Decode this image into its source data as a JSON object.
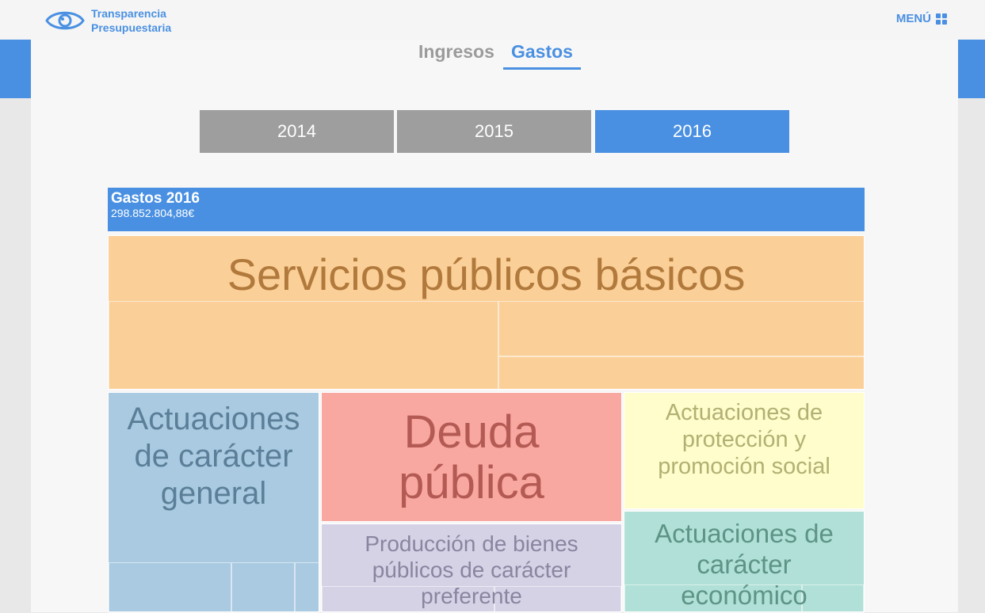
{
  "header": {
    "logo_line1": "Transparencia",
    "logo_line2": "Presupuestaria",
    "menu_label": "MENÚ"
  },
  "tabs": [
    {
      "label": "Ingresos",
      "active": false
    },
    {
      "label": "Gastos",
      "active": true
    }
  ],
  "years": [
    {
      "label": "2014",
      "active": false
    },
    {
      "label": "2015",
      "active": false
    },
    {
      "label": "2016",
      "active": true
    }
  ],
  "treemap": {
    "title": "Gastos 2016",
    "total": "298.852.804,88€",
    "items": [
      {
        "label": "Servicios públicos básicos",
        "color": "#fbcf98",
        "text_color": "#b17a3c"
      },
      {
        "label": "Actuaciones de carácter general",
        "color": "#a9cae0",
        "text_color": "#5b7f98"
      },
      {
        "label": "Deuda pública",
        "color": "#f8a8a0",
        "text_color": "#b45a54"
      },
      {
        "label": "Actuaciones de protección y promoción social",
        "color": "#fefdcb",
        "text_color": "#b3b073"
      },
      {
        "label": "Producción de bienes públicos de carácter preferente",
        "color": "#d5d2e6",
        "text_color": "#8a85a0"
      },
      {
        "label": "Actuaciones de carácter económico",
        "color": "#b0e0d7",
        "text_color": "#5e9487"
      }
    ]
  },
  "colors": {
    "accent": "#4a90e2",
    "inactive_year": "#9e9e9e"
  }
}
